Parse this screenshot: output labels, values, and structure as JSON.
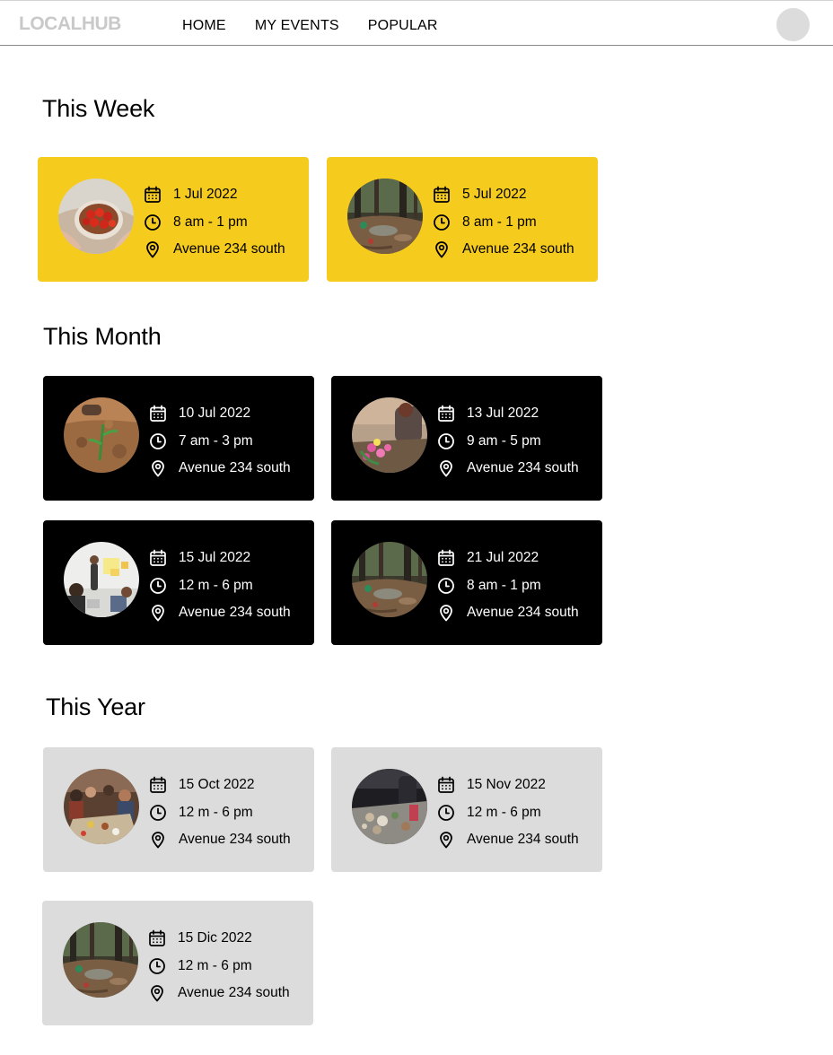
{
  "nav": {
    "logo": "LOCALHUB",
    "items": [
      "HOME",
      "MY EVENTS",
      "POPULAR"
    ]
  },
  "sections": {
    "week": {
      "title": "This Week",
      "events": [
        {
          "date": "1 Jul 2022",
          "time": "8 am - 1 pm",
          "location": "Avenue 234 south",
          "image": "tomatoes"
        },
        {
          "date": "5 Jul 2022",
          "time": "8 am - 1 pm",
          "location": "Avenue 234 south",
          "image": "forest"
        }
      ]
    },
    "month": {
      "title": "This Month",
      "events": [
        {
          "date": "10 Jul 2022",
          "time": "7 am - 3 pm",
          "location": "Avenue 234 south",
          "image": "soil-planting"
        },
        {
          "date": "13 Jul 2022",
          "time": "9 am - 5 pm",
          "location": "Avenue 234 south",
          "image": "flower-planting"
        },
        {
          "date": "15 Jul 2022",
          "time": "12 m - 6 pm",
          "location": "Avenue 234 south",
          "image": "workshop"
        },
        {
          "date": "21 Jul 2022",
          "time": "8 am - 1 pm",
          "location": "Avenue 234 south",
          "image": "forest"
        }
      ]
    },
    "year": {
      "title": "This Year",
      "events": [
        {
          "date": "15 Oct 2022",
          "time": "12 m - 6 pm",
          "location": "Avenue 234 south",
          "image": "community-dinner"
        },
        {
          "date": "15 Nov 2022",
          "time": "12 m - 6 pm",
          "location": "Avenue 234 south",
          "image": "market-table"
        },
        {
          "date": "15 Dic 2022",
          "time": "12 m - 6 pm",
          "location": "Avenue 234 south",
          "image": "forest"
        }
      ]
    }
  },
  "icons": {
    "date": "calendar-icon",
    "time": "clock-icon",
    "location": "location-pin-icon"
  },
  "colors": {
    "week_card": "#f5cb1e",
    "month_card": "#000000",
    "year_card": "#dcdcdc",
    "logo": "#c9c9c9"
  }
}
